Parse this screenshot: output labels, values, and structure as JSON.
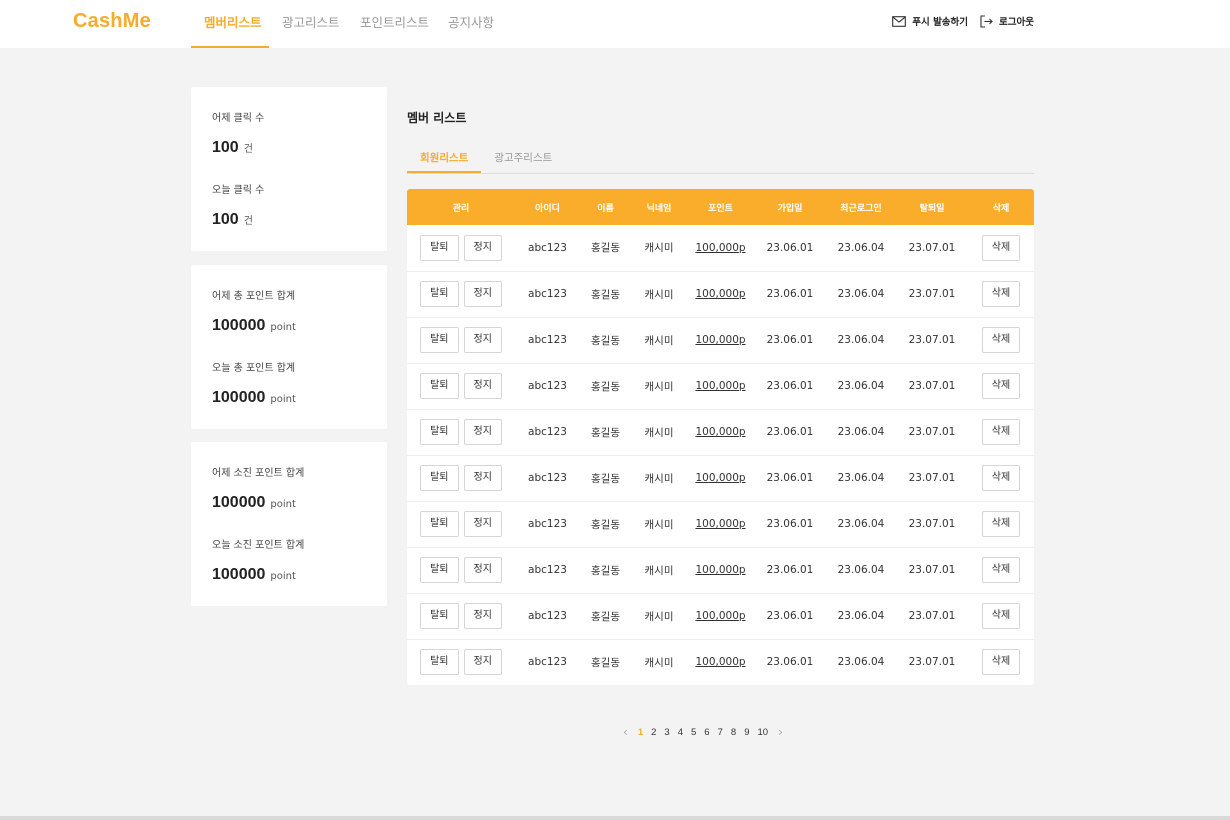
{
  "header": {
    "logo": "CashMe",
    "nav": [
      {
        "label": "멤버리스트",
        "active": true
      },
      {
        "label": "광고리스트",
        "active": false
      },
      {
        "label": "포인트리스트",
        "active": false
      },
      {
        "label": "공지사항",
        "active": false
      }
    ],
    "push_label": "푸시 발송하기",
    "logout_label": "로그아웃"
  },
  "stats": {
    "card1": {
      "yesterday_label": "어제 클릭 수",
      "yesterday_value": "100",
      "yesterday_unit": "건",
      "today_label": "오늘 클릭 수",
      "today_value": "100",
      "today_unit": "건"
    },
    "card2": {
      "yesterday_label": "어제 총 포인트 합계",
      "yesterday_value": "100000",
      "yesterday_unit": "point",
      "today_label": "오늘 총 포인트 합계",
      "today_value": "100000",
      "today_unit": "point"
    },
    "card3": {
      "yesterday_label": "어제 소진 포인트 합계",
      "yesterday_value": "100000",
      "yesterday_unit": "point",
      "today_label": "오늘 소진 포인트 합계",
      "today_value": "100000",
      "today_unit": "point"
    }
  },
  "main": {
    "title": "멤버 리스트",
    "tabs": [
      {
        "label": "회원리스트",
        "active": true
      },
      {
        "label": "광고주리스트",
        "active": false
      }
    ]
  },
  "table": {
    "headers": [
      "관리",
      "아이디",
      "이름",
      "닉네임",
      "포인트",
      "가입일",
      "최근로그인",
      "탈퇴일",
      "삭제"
    ],
    "withdraw_label": "탈퇴",
    "suspend_label": "정지",
    "delete_label": "삭제",
    "rows": [
      {
        "id": "abc123",
        "name": "홍길동",
        "nickname": "캐시미",
        "points": "100,000p",
        "joined": "23.06.01",
        "last_login": "23.06.04",
        "withdrawn": "23.07.01"
      },
      {
        "id": "abc123",
        "name": "홍길동",
        "nickname": "캐시미",
        "points": "100,000p",
        "joined": "23.06.01",
        "last_login": "23.06.04",
        "withdrawn": "23.07.01"
      },
      {
        "id": "abc123",
        "name": "홍길동",
        "nickname": "캐시미",
        "points": "100,000p",
        "joined": "23.06.01",
        "last_login": "23.06.04",
        "withdrawn": "23.07.01"
      },
      {
        "id": "abc123",
        "name": "홍길동",
        "nickname": "캐시미",
        "points": "100,000p",
        "joined": "23.06.01",
        "last_login": "23.06.04",
        "withdrawn": "23.07.01"
      },
      {
        "id": "abc123",
        "name": "홍길동",
        "nickname": "캐시미",
        "points": "100,000p",
        "joined": "23.06.01",
        "last_login": "23.06.04",
        "withdrawn": "23.07.01"
      },
      {
        "id": "abc123",
        "name": "홍길동",
        "nickname": "캐시미",
        "points": "100,000p",
        "joined": "23.06.01",
        "last_login": "23.06.04",
        "withdrawn": "23.07.01"
      },
      {
        "id": "abc123",
        "name": "홍길동",
        "nickname": "캐시미",
        "points": "100,000p",
        "joined": "23.06.01",
        "last_login": "23.06.04",
        "withdrawn": "23.07.01"
      },
      {
        "id": "abc123",
        "name": "홍길동",
        "nickname": "캐시미",
        "points": "100,000p",
        "joined": "23.06.01",
        "last_login": "23.06.04",
        "withdrawn": "23.07.01"
      },
      {
        "id": "abc123",
        "name": "홍길동",
        "nickname": "캐시미",
        "points": "100,000p",
        "joined": "23.06.01",
        "last_login": "23.06.04",
        "withdrawn": "23.07.01"
      },
      {
        "id": "abc123",
        "name": "홍길동",
        "nickname": "캐시미",
        "points": "100,000p",
        "joined": "23.06.01",
        "last_login": "23.06.04",
        "withdrawn": "23.07.01"
      }
    ]
  },
  "pagination": {
    "pages": [
      "1",
      "2",
      "3",
      "4",
      "5",
      "6",
      "7",
      "8",
      "9",
      "10"
    ],
    "current": "1",
    "prev_icon": "chevron-left-icon",
    "next_icon": "chevron-right-icon"
  },
  "colors": {
    "accent": "#f5ac2c",
    "table_header": "#f9ad2b",
    "background": "#f3f3f3"
  }
}
